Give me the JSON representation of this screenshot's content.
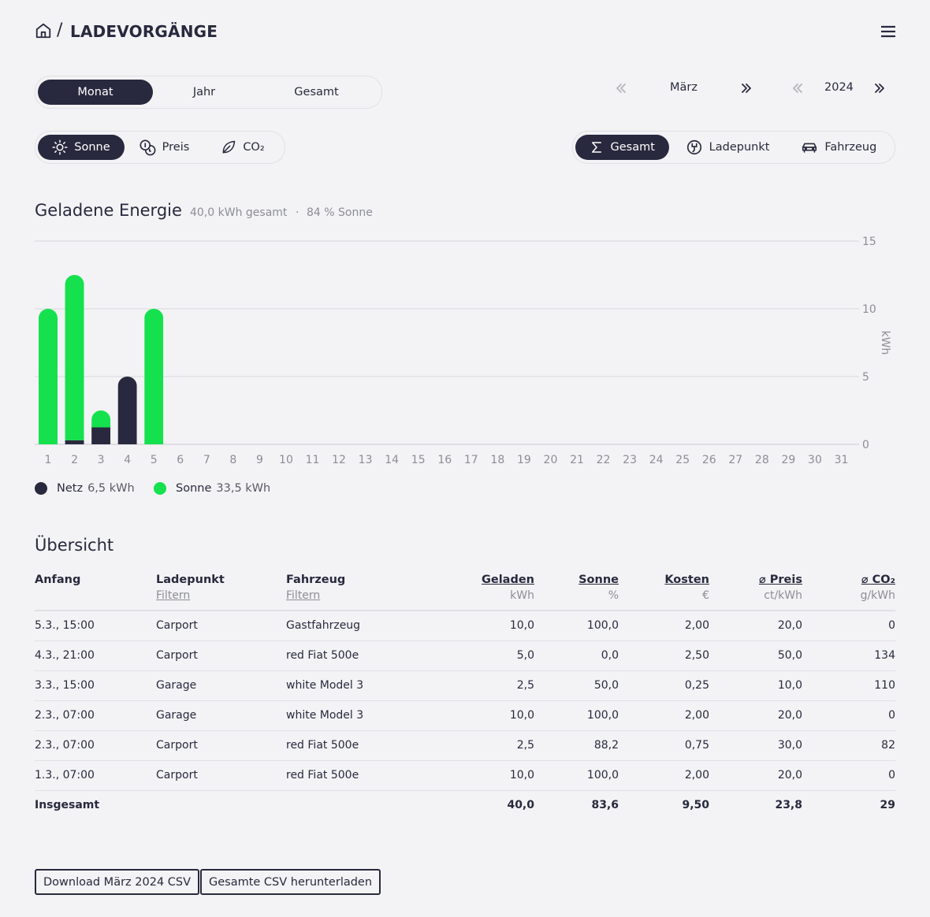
{
  "header": {
    "title": "LADEVORGÄNGE",
    "separator": "/"
  },
  "period_tabs": [
    {
      "label": "Monat",
      "active": true
    },
    {
      "label": "Jahr",
      "active": false
    },
    {
      "label": "Gesamt",
      "active": false
    }
  ],
  "period_nav": {
    "month": "März",
    "year": "2024"
  },
  "metric_tabs": [
    {
      "label": "Sonne",
      "icon": "sun-icon",
      "active": true
    },
    {
      "label": "Preis",
      "icon": "coins-icon",
      "active": false
    },
    {
      "label": "CO₂",
      "icon": "leaf-icon",
      "active": false
    }
  ],
  "group_tabs": [
    {
      "label": "Gesamt",
      "icon": "sigma-icon",
      "active": true
    },
    {
      "label": "Ladepunkt",
      "icon": "charger-icon",
      "active": false
    },
    {
      "label": "Fahrzeug",
      "icon": "car-icon",
      "active": false
    }
  ],
  "energy": {
    "title": "Geladene Energie",
    "total_text": "40,0 kWh gesamt",
    "dot": "·",
    "solar_text": "84 % Sonne"
  },
  "chart_data": {
    "type": "bar",
    "stacked": true,
    "categories": [
      "1",
      "2",
      "3",
      "4",
      "5",
      "6",
      "7",
      "8",
      "9",
      "10",
      "11",
      "12",
      "13",
      "14",
      "15",
      "16",
      "17",
      "18",
      "19",
      "20",
      "21",
      "22",
      "23",
      "24",
      "25",
      "26",
      "27",
      "28",
      "29",
      "30",
      "31"
    ],
    "series": [
      {
        "name": "Netz",
        "color": "#28293e",
        "values": [
          0,
          0.3,
          1.25,
          5.0,
          0,
          0,
          0,
          0,
          0,
          0,
          0,
          0,
          0,
          0,
          0,
          0,
          0,
          0,
          0,
          0,
          0,
          0,
          0,
          0,
          0,
          0,
          0,
          0,
          0,
          0,
          0
        ]
      },
      {
        "name": "Sonne",
        "color": "#15e14e",
        "values": [
          10.0,
          12.2,
          1.25,
          0,
          10.0,
          0,
          0,
          0,
          0,
          0,
          0,
          0,
          0,
          0,
          0,
          0,
          0,
          0,
          0,
          0,
          0,
          0,
          0,
          0,
          0,
          0,
          0,
          0,
          0,
          0,
          0
        ]
      }
    ],
    "y_ticks": [
      0,
      5,
      10,
      15
    ],
    "ylim": [
      0,
      15
    ],
    "ylabel": "kWh",
    "grid": true
  },
  "legend": [
    {
      "name": "Netz",
      "value": "6,5 kWh",
      "color": "#28293e"
    },
    {
      "name": "Sonne",
      "value": "33,5 kWh",
      "color": "#15e14e"
    }
  ],
  "overview": {
    "title": "Übersicht",
    "columns": {
      "start": "Anfang",
      "chargepoint": "Ladepunkt",
      "vehicle": "Fahrzeug",
      "filter": "Filtern",
      "charged": "Geladen",
      "charged_unit": "kWh",
      "solar": "Sonne",
      "solar_unit": "%",
      "cost": "Kosten",
      "cost_unit": "€",
      "price": "⌀ Preis",
      "price_unit": "ct/kWh",
      "co2": "⌀ CO₂",
      "co2_unit": "g/kWh"
    },
    "rows": [
      [
        "5.3., 15:00",
        "Carport",
        "Gastfahrzeug",
        "10,0",
        "100,0",
        "2,00",
        "20,0",
        "0"
      ],
      [
        "4.3., 21:00",
        "Carport",
        "red Fiat 500e",
        "5,0",
        "0,0",
        "2,50",
        "50,0",
        "134"
      ],
      [
        "3.3., 15:00",
        "Garage",
        "white Model 3",
        "2,5",
        "50,0",
        "0,25",
        "10,0",
        "110"
      ],
      [
        "2.3., 07:00",
        "Garage",
        "white Model 3",
        "10,0",
        "100,0",
        "2,00",
        "20,0",
        "0"
      ],
      [
        "2.3., 07:00",
        "Carport",
        "red Fiat 500e",
        "2,5",
        "88,2",
        "0,75",
        "30,0",
        "82"
      ],
      [
        "1.3., 07:00",
        "Carport",
        "red Fiat 500e",
        "10,0",
        "100,0",
        "2,00",
        "20,0",
        "0"
      ]
    ],
    "total": [
      "Insgesamt",
      "",
      "",
      "40,0",
      "83,6",
      "9,50",
      "23,8",
      "29"
    ]
  },
  "downloads": {
    "month_csv": "Download März 2024 CSV",
    "all_csv": "Gesamte CSV herunterladen"
  }
}
